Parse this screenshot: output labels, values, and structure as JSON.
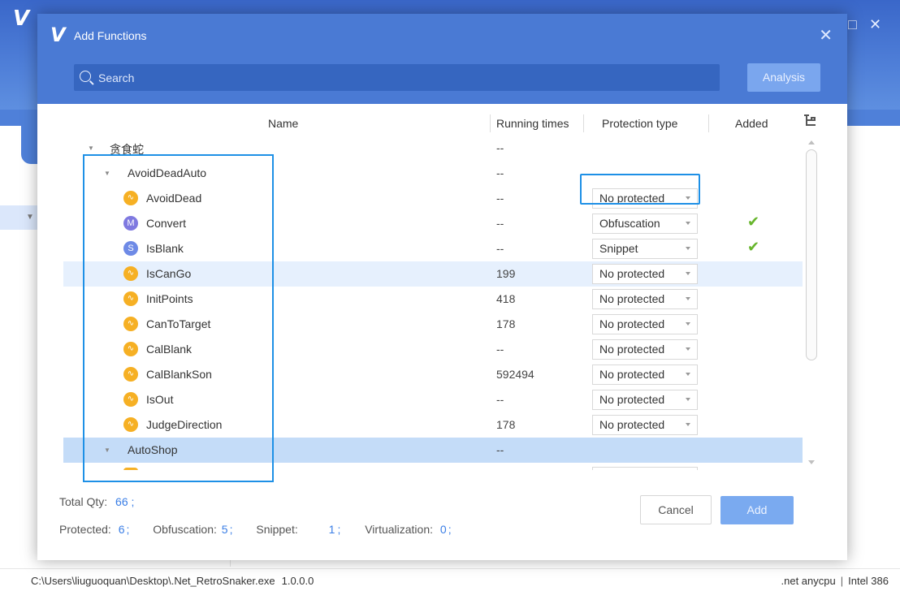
{
  "app": {
    "logo": "V",
    "window_controls": [
      "□",
      "✕"
    ]
  },
  "dialog": {
    "logo": "V",
    "title": "Add Functions",
    "close": "✕",
    "search_placeholder": "Search",
    "analysis_label": "Analysis"
  },
  "table": {
    "columns": {
      "name": "Name",
      "running_times": "Running times",
      "protection_type": "Protection type",
      "added": "Added"
    },
    "rows": [
      {
        "name": "贪食蛇",
        "times": "--",
        "level": 0,
        "expandable": true
      },
      {
        "name": "AvoidDeadAuto",
        "times": "--",
        "level": 1,
        "expandable": true
      },
      {
        "name": "AvoidDead",
        "times": "--",
        "icon": "function-icon",
        "protection": "No protected",
        "added": ""
      },
      {
        "name": "Convert",
        "times": "--",
        "icon": "method-icon",
        "icon_letter": "M",
        "protection": "Obfuscation",
        "added": "✔"
      },
      {
        "name": "IsBlank",
        "times": "--",
        "icon": "snippet-icon",
        "icon_letter": "S",
        "protection": "Snippet",
        "added": "✔"
      },
      {
        "name": "IsCanGo",
        "times": "199",
        "icon": "function-icon",
        "protection": "No protected",
        "added": ""
      },
      {
        "name": "InitPoints",
        "times": "418",
        "icon": "function-icon",
        "protection": "No protected",
        "added": ""
      },
      {
        "name": "CanToTarget",
        "times": "178",
        "icon": "function-icon",
        "protection": "No protected",
        "added": ""
      },
      {
        "name": "CalBlank",
        "times": "--",
        "icon": "function-icon",
        "protection": "No protected",
        "added": ""
      },
      {
        "name": "CalBlankSon",
        "times": "592494",
        "icon": "function-icon",
        "protection": "No protected",
        "added": ""
      },
      {
        "name": "IsOut",
        "times": "--",
        "icon": "function-icon",
        "protection": "No protected",
        "added": ""
      },
      {
        "name": "JudgeDirection",
        "times": "178",
        "icon": "function-icon",
        "protection": "No protected",
        "added": ""
      },
      {
        "name": "AutoShop",
        "times": "--",
        "level": 1,
        "expandable": true
      }
    ]
  },
  "footer": {
    "total_label": "Total Qty:",
    "total_value": "66",
    "protected_label": "Protected:",
    "protected_value": "6",
    "obfuscation_label": "Obfuscation:",
    "obfuscation_value": "5",
    "snippet_label": "Snippet:",
    "snippet_value": "1",
    "virtualization_label": "Virtualization:",
    "virtualization_value": "0",
    "separator": ";",
    "cancel_label": "Cancel",
    "add_label": "Add"
  },
  "status": {
    "path": "C:\\Users\\liuguoquan\\Desktop\\.Net_RetroSnaker.exe",
    "version": "1.0.0.0",
    "runtime": ".net anycpu",
    "separator": "|",
    "arch": "Intel 386"
  },
  "colors": {
    "header_blue": "#4a7ad4",
    "accent_blue": "#3a7ee6",
    "highlight_outline": "#1e90e6",
    "function_icon": "#f6b024",
    "check_green": "#66b52b"
  }
}
